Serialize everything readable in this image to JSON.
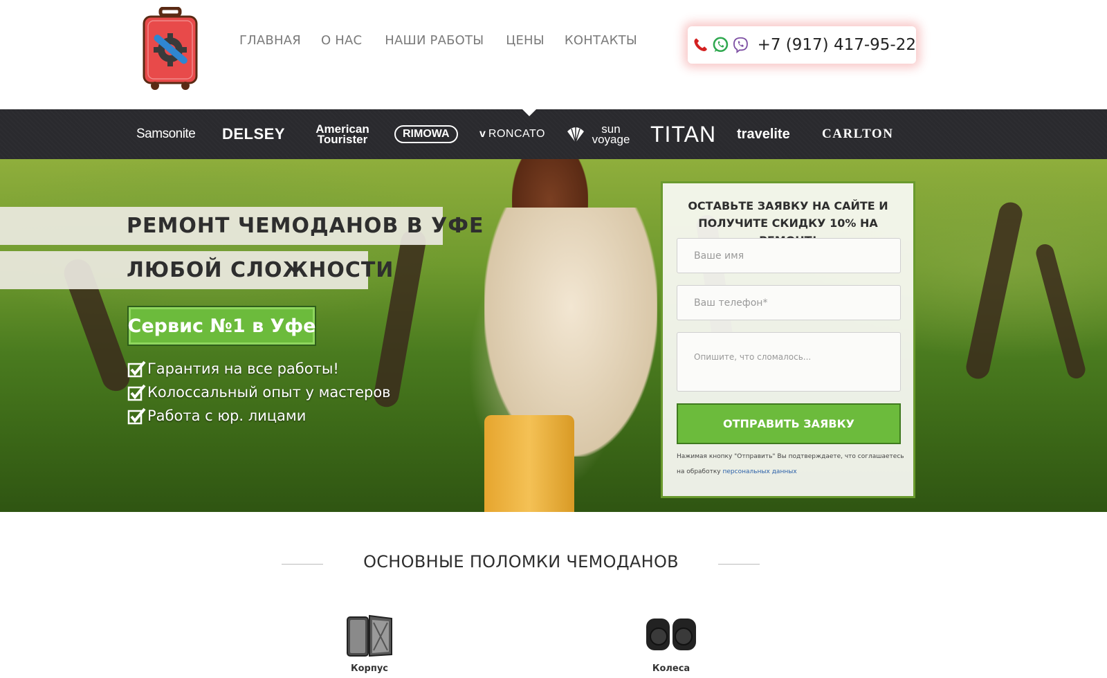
{
  "nav": {
    "items": [
      "ГЛАВНАЯ",
      "О НАС",
      "НАШИ РАБОТЫ",
      "ЦЕНЫ",
      "КОНТАКТЫ"
    ]
  },
  "contact": {
    "phone": "+7 (917) 417-95-22",
    "icons": [
      "phone-icon",
      "whatsapp-icon",
      "viber-icon"
    ]
  },
  "brands": [
    "Samsonite",
    "DELSEY",
    "American Tourister",
    "RIMOWA",
    "RONCATO",
    "sun voyage",
    "TITAN",
    "travelite",
    "CARLTON"
  ],
  "hero": {
    "title_line1": "РЕМОНТ ЧЕМОДАНОВ В УФЕ",
    "title_line2": "ЛЮБОЙ СЛОЖНОСТИ",
    "badge": "Сервис №1 в Уфе",
    "benefits": [
      "Гарантия на все работы!",
      "Колоссальный опыт у мастеров",
      "Работа с юр. лицами"
    ]
  },
  "form": {
    "title": "ОСТАВЬТЕ ЗАЯВКУ НА САЙТЕ И ПОЛУЧИТЕ СКИДКУ 10% НА РЕМОНТ!",
    "name_placeholder": "Ваше имя",
    "phone_placeholder": "Ваш телефон*",
    "message_placeholder": "Опишите, что сломалось...",
    "submit": "ОТПРАВИТЬ ЗАЯВКУ",
    "consent_text": "Нажимая кнопку \"Отправить\" Вы подтверждаете, что соглашаетесь на обработку",
    "consent_link": "персональных данных"
  },
  "section": {
    "title": "ОСНОВНЫЕ ПОЛОМКИ ЧЕМОДАНОВ",
    "items": [
      "Корпус",
      "Колеса"
    ]
  },
  "colors": {
    "accent_green": "#6cbb3c",
    "brand_bar": "#2a2a2e",
    "logo_red": "#e84a4a",
    "logo_blue": "#2f86d1"
  }
}
